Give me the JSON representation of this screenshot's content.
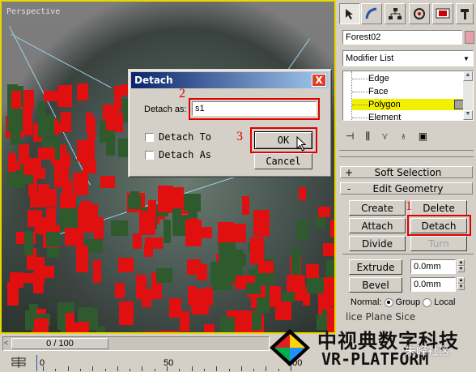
{
  "viewport": {
    "label": "Perspective"
  },
  "toolbar": {
    "icons": [
      "pointer-icon",
      "arc-icon",
      "hierarchy-icon",
      "motion-icon",
      "display-icon",
      "utilities-icon"
    ]
  },
  "object_name": "Forest02",
  "modifier_list": {
    "label": "Modifier List"
  },
  "subobjects": [
    "Edge",
    "Face",
    "Polygon",
    "Element"
  ],
  "subobject_selected": "Polygon",
  "rollouts": {
    "soft_selection": {
      "sign": "+",
      "title": "Soft Selection"
    },
    "edit_geometry": {
      "sign": "-",
      "title": "Edit Geometry"
    }
  },
  "buttons": {
    "create": "Create",
    "delete": "Delete",
    "attach": "Attach",
    "detach": "Detach",
    "divide": "Divide",
    "turn": "Turn",
    "extrude": "Extrude",
    "bevel": "Bevel"
  },
  "extrude_value": "0.0mm",
  "bevel_value": "0.0mm",
  "normal": {
    "label": "Normal:",
    "group": "Group",
    "local": "Local"
  },
  "partial_label": "lice Plane  Sice",
  "dialog": {
    "title": "Detach",
    "close": "X",
    "detach_as_label": "Detach as:",
    "detach_as_value": "s1",
    "detach_to": "Detach To",
    "detach_as_clone": "Detach As",
    "ok": "OK",
    "cancel": "Cancel"
  },
  "steps": {
    "one": "1",
    "two": "2",
    "three": "3"
  },
  "timeline": {
    "frame": "0 / 100",
    "ticks": [
      "0",
      "50",
      "100"
    ]
  },
  "watermark": {
    "chinese": "中视典数字科技",
    "english": "VR-PLATFORM",
    "overlay": "朱峰社区"
  }
}
